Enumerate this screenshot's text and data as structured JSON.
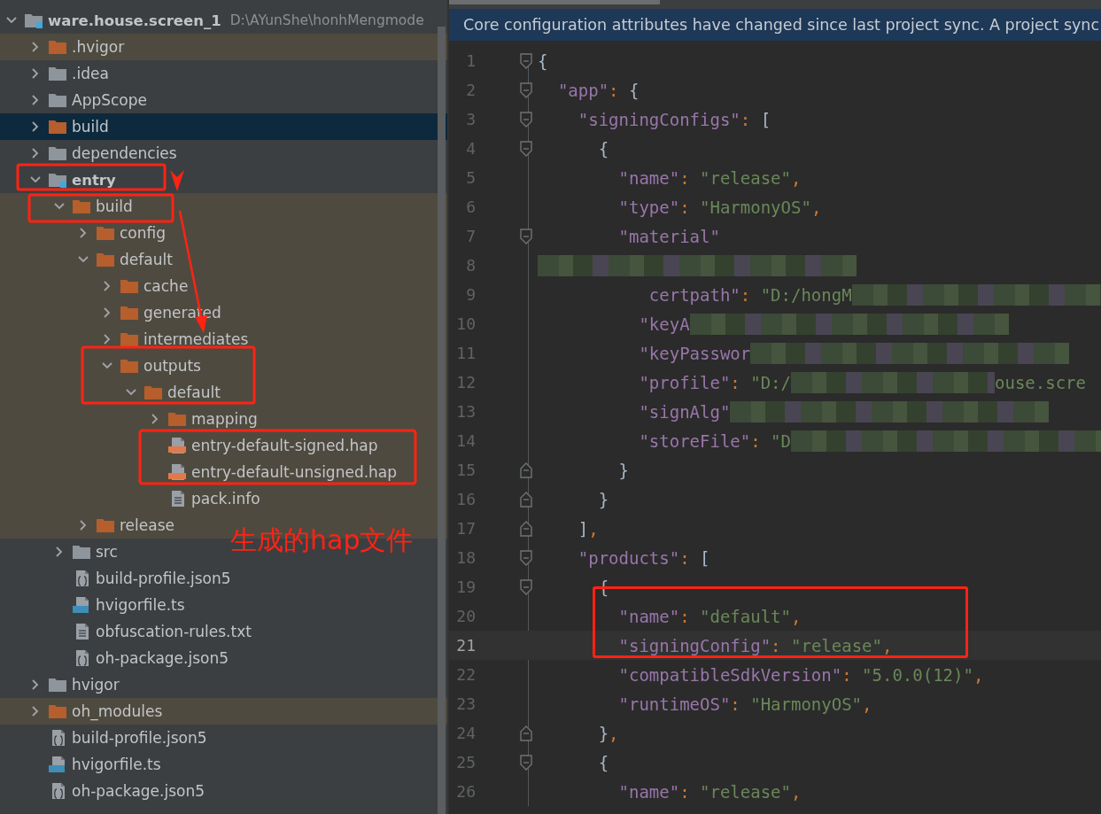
{
  "project_tree": {
    "root": {
      "label": "ware.house.screen_1",
      "path": "D:\\AYunShe\\honhMengmode",
      "kind": "module",
      "expanded": true,
      "selected": false,
      "children": [
        {
          "label": ".hvigor",
          "kind": "folder-orange",
          "expanded": false,
          "selected": false,
          "excluded": true
        },
        {
          "label": ".idea",
          "kind": "folder",
          "expanded": false,
          "selected": false
        },
        {
          "label": "AppScope",
          "kind": "folder",
          "expanded": false,
          "selected": false
        },
        {
          "label": "build",
          "kind": "folder-orange",
          "expanded": false,
          "selected": true
        },
        {
          "label": "dependencies",
          "kind": "folder",
          "expanded": false,
          "selected": false
        },
        {
          "label": "entry",
          "kind": "module",
          "expanded": true,
          "selected": false,
          "children": [
            {
              "label": "build",
              "kind": "folder-orange",
              "expanded": true,
              "selected": false,
              "excluded": true,
              "children": [
                {
                  "label": "config",
                  "kind": "folder-orange",
                  "expanded": false,
                  "selected": false
                },
                {
                  "label": "default",
                  "kind": "folder-orange",
                  "expanded": true,
                  "selected": false,
                  "children": [
                    {
                      "label": "cache",
                      "kind": "folder-orange",
                      "expanded": false,
                      "selected": false
                    },
                    {
                      "label": "generated",
                      "kind": "folder-orange",
                      "expanded": false,
                      "selected": false
                    },
                    {
                      "label": "intermediates",
                      "kind": "folder-orange",
                      "expanded": false,
                      "selected": false
                    },
                    {
                      "label": "outputs",
                      "kind": "folder-orange",
                      "expanded": true,
                      "selected": false,
                      "children": [
                        {
                          "label": "default",
                          "kind": "folder-orange",
                          "expanded": true,
                          "selected": false,
                          "children": [
                            {
                              "label": "mapping",
                              "kind": "folder-orange",
                              "expanded": false,
                              "selected": false
                            },
                            {
                              "label": "entry-default-signed.hap",
                              "kind": "hap",
                              "selected": false
                            },
                            {
                              "label": "entry-default-unsigned.hap",
                              "kind": "hap",
                              "selected": false
                            },
                            {
                              "label": "pack.info",
                              "kind": "text-file",
                              "selected": false
                            }
                          ]
                        }
                      ]
                    }
                  ]
                },
                {
                  "label": "release",
                  "kind": "folder-orange",
                  "expanded": false,
                  "selected": false
                }
              ]
            },
            {
              "label": "src",
              "kind": "folder",
              "expanded": false,
              "selected": false
            },
            {
              "label": "build-profile.json5",
              "kind": "json5",
              "selected": false
            },
            {
              "label": "hvigorfile.ts",
              "kind": "ts",
              "selected": false
            },
            {
              "label": "obfuscation-rules.txt",
              "kind": "text-file",
              "selected": false
            },
            {
              "label": "oh-package.json5",
              "kind": "json5",
              "selected": false
            }
          ]
        },
        {
          "label": "hvigor",
          "kind": "folder",
          "expanded": false,
          "selected": false
        },
        {
          "label": "oh_modules",
          "kind": "folder-orange",
          "expanded": false,
          "selected": false,
          "excluded": true
        },
        {
          "label": "build-profile.json5",
          "kind": "json5",
          "selected": false
        },
        {
          "label": "hvigorfile.ts",
          "kind": "ts",
          "selected": false
        },
        {
          "label": "oh-package.json5",
          "kind": "json5",
          "selected": false
        }
      ]
    }
  },
  "annotation": {
    "note": "生成的hap文件"
  },
  "editor": {
    "notification": "Core configuration attributes have changed since last project sync. A project sync",
    "lines": [
      {
        "num": "1",
        "fold": {
          "kind": "open"
        },
        "current": false,
        "tokens": [
          {
            "kind": "brace",
            "t": "{"
          }
        ]
      },
      {
        "num": "2",
        "fold": {
          "kind": "open"
        },
        "current": false,
        "tokens": [
          {
            "kind": "key",
            "t": "  \"app\""
          },
          {
            "kind": "punct",
            "t": ": "
          },
          {
            "kind": "brace",
            "t": "{"
          }
        ]
      },
      {
        "num": "3",
        "fold": {
          "kind": "open"
        },
        "current": false,
        "tokens": [
          {
            "kind": "key",
            "t": "    \"signingConfigs\""
          },
          {
            "kind": "punct",
            "t": ": "
          },
          {
            "kind": "brace",
            "t": "["
          }
        ]
      },
      {
        "num": "4",
        "fold": {
          "kind": "open"
        },
        "current": false,
        "tokens": [
          {
            "kind": "brace",
            "t": "      {"
          }
        ]
      },
      {
        "num": "5",
        "current": false,
        "tokens": [
          {
            "kind": "key",
            "t": "        \"name\""
          },
          {
            "kind": "punct",
            "t": ": "
          },
          {
            "kind": "str",
            "t": "\"release\""
          },
          {
            "kind": "punct",
            "t": ","
          }
        ]
      },
      {
        "num": "6",
        "current": false,
        "tokens": [
          {
            "kind": "key",
            "t": "        \"type\""
          },
          {
            "kind": "punct",
            "t": ": "
          },
          {
            "kind": "str",
            "t": "\"HarmonyOS\""
          },
          {
            "kind": "punct",
            "t": ","
          }
        ]
      },
      {
        "num": "7",
        "fold": {
          "kind": "open"
        },
        "current": false,
        "tokens": [
          {
            "kind": "key",
            "t": "        \"material\""
          }
        ]
      },
      {
        "num": "8",
        "current": false,
        "tokens": [
          {
            "kind": "blur"
          }
        ]
      },
      {
        "num": "9",
        "current": false,
        "tokens": [
          {
            "kind": "key",
            "t": "           certpath\""
          },
          {
            "kind": "punct",
            "t": ": "
          },
          {
            "kind": "str",
            "t": "\"D:/hongM"
          },
          {
            "kind": "blur"
          }
        ]
      },
      {
        "num": "10",
        "current": false,
        "tokens": [
          {
            "kind": "key",
            "t": "          \"keyA"
          },
          {
            "kind": "blur"
          }
        ]
      },
      {
        "num": "11",
        "current": false,
        "tokens": [
          {
            "kind": "key",
            "t": "          \"keyPasswor"
          },
          {
            "kind": "blur"
          }
        ]
      },
      {
        "num": "12",
        "current": false,
        "tokens": [
          {
            "kind": "key",
            "t": "          \"profile\""
          },
          {
            "kind": "punct",
            "t": ": "
          },
          {
            "kind": "str",
            "t": "\"D:/"
          },
          {
            "kind": "blur-short"
          },
          {
            "kind": "str",
            "t": "ouse.scre"
          }
        ]
      },
      {
        "num": "13",
        "current": false,
        "tokens": [
          {
            "kind": "key",
            "t": "          \"signAlg\""
          },
          {
            "kind": "blur"
          }
        ]
      },
      {
        "num": "14",
        "current": false,
        "tokens": [
          {
            "kind": "key",
            "t": "          \"storeFile\""
          },
          {
            "kind": "punct",
            "t": ": "
          },
          {
            "kind": "str",
            "t": "\"D"
          },
          {
            "kind": "blur"
          }
        ]
      },
      {
        "num": "15",
        "fold": {
          "kind": "close"
        },
        "current": false,
        "tokens": [
          {
            "kind": "brace",
            "t": "        }"
          }
        ]
      },
      {
        "num": "16",
        "fold": {
          "kind": "close"
        },
        "current": false,
        "tokens": [
          {
            "kind": "brace",
            "t": "      }"
          }
        ]
      },
      {
        "num": "17",
        "fold": {
          "kind": "close"
        },
        "current": false,
        "tokens": [
          {
            "kind": "brace",
            "t": "    ]"
          },
          {
            "kind": "punct",
            "t": ","
          }
        ]
      },
      {
        "num": "18",
        "fold": {
          "kind": "open"
        },
        "current": false,
        "tokens": [
          {
            "kind": "key",
            "t": "    \"products\""
          },
          {
            "kind": "punct",
            "t": ": "
          },
          {
            "kind": "brace",
            "t": "["
          }
        ]
      },
      {
        "num": "19",
        "fold": {
          "kind": "open"
        },
        "current": false,
        "tokens": [
          {
            "kind": "brace",
            "t": "      {"
          }
        ]
      },
      {
        "num": "20",
        "current": false,
        "tokens": [
          {
            "kind": "key",
            "t": "        \"name\""
          },
          {
            "kind": "punct",
            "t": ": "
          },
          {
            "kind": "str",
            "t": "\"default\""
          },
          {
            "kind": "punct",
            "t": ","
          }
        ]
      },
      {
        "num": "21",
        "current": true,
        "tokens": [
          {
            "kind": "key",
            "t": "        \"signingConfig\""
          },
          {
            "kind": "punct",
            "t": ": "
          },
          {
            "kind": "str",
            "t": "\"release\""
          },
          {
            "kind": "punct",
            "t": ","
          }
        ]
      },
      {
        "num": "22",
        "current": false,
        "tokens": [
          {
            "kind": "key",
            "t": "        \"compatibleSdkVersion\""
          },
          {
            "kind": "punct",
            "t": ": "
          },
          {
            "kind": "str",
            "t": "\"5.0.0(12)\""
          },
          {
            "kind": "punct",
            "t": ","
          }
        ]
      },
      {
        "num": "23",
        "current": false,
        "tokens": [
          {
            "kind": "key",
            "t": "        \"runtimeOS\""
          },
          {
            "kind": "punct",
            "t": ": "
          },
          {
            "kind": "str",
            "t": "\"HarmonyOS\""
          },
          {
            "kind": "punct",
            "t": ","
          }
        ]
      },
      {
        "num": "24",
        "fold": {
          "kind": "close"
        },
        "current": false,
        "tokens": [
          {
            "kind": "brace",
            "t": "      }"
          },
          {
            "kind": "punct",
            "t": ","
          }
        ]
      },
      {
        "num": "25",
        "fold": {
          "kind": "open"
        },
        "current": false,
        "tokens": [
          {
            "kind": "brace",
            "t": "      {"
          }
        ]
      },
      {
        "num": "26",
        "current": false,
        "tokens": [
          {
            "kind": "key",
            "t": "        \"name\""
          },
          {
            "kind": "punct",
            "t": ": "
          },
          {
            "kind": "str",
            "t": "\"release\""
          },
          {
            "kind": "punct",
            "t": ","
          }
        ]
      }
    ]
  }
}
